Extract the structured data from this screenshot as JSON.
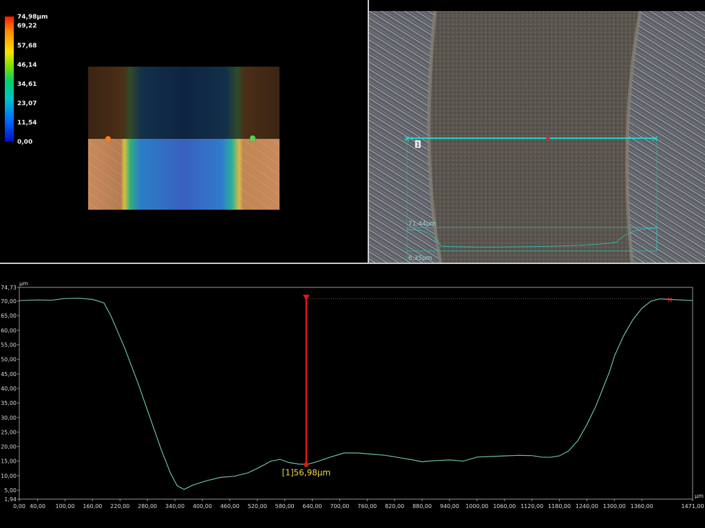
{
  "color_scale": {
    "labels": [
      "74,98µm",
      "69,22",
      "57,68",
      "46,14",
      "34,61",
      "23,07",
      "11,54",
      "0,00"
    ],
    "colors": [
      "#ff1a00",
      "#ff8a00",
      "#ffe000",
      "#7be000",
      "#00d070",
      "#00c4c8",
      "#0070ff",
      "#0010c8"
    ]
  },
  "optical_view": {
    "marker_label": "1",
    "height_label": "71,44µm",
    "depth_label": "6,35µm",
    "line_color": "#20d8d0"
  },
  "profile": {
    "unit_y": "µm",
    "unit_x": "µm",
    "measurement_label": "[1]56,98µm",
    "y_ticks": [
      "74,73",
      "70,00",
      "65,00",
      "60,00",
      "55,00",
      "50,00",
      "45,00",
      "40,00",
      "35,00",
      "30,00",
      "25,00",
      "20,00",
      "15,00",
      "10,00",
      "5,00",
      "1,94"
    ],
    "x_ticks": [
      "0,00",
      "40,00",
      "100,00",
      "160,00",
      "220,00",
      "280,00",
      "340,00",
      "400,00",
      "460,00",
      "520,00",
      "580,00",
      "640,00",
      "700,00",
      "760,00",
      "820,00",
      "880,00",
      "940,00",
      "1000,00",
      "1060,00",
      "1120,00",
      "1180,00",
      "1240,00",
      "1300,00",
      "1360,00",
      "1471,00"
    ]
  },
  "chart_data": {
    "type": "line",
    "title": "",
    "xlabel": "µm",
    "ylabel": "µm",
    "xlim": [
      0,
      1471
    ],
    "ylim": [
      1.94,
      74.73
    ],
    "series": [
      {
        "color": "#6fc1a6",
        "x": [
          0,
          40,
          70,
          100,
          130,
          160,
          185,
          200,
          230,
          260,
          290,
          310,
          330,
          345,
          360,
          380,
          410,
          440,
          470,
          500,
          520,
          550,
          570,
          590,
          610,
          630,
          650,
          680,
          710,
          740,
          770,
          800,
          830,
          860,
          880,
          910,
          940,
          970,
          1000,
          1030,
          1060,
          1090,
          1120,
          1140,
          1160,
          1180,
          1200,
          1220,
          1240,
          1260,
          1275,
          1290,
          1300,
          1320,
          1340,
          1360,
          1380,
          1400,
          1420,
          1471
        ],
        "y": [
          70.2,
          70.4,
          70.3,
          70.9,
          71.0,
          70.6,
          69.4,
          65.0,
          54.0,
          41.5,
          28.0,
          19.0,
          11.0,
          6.5,
          5.3,
          6.8,
          8.3,
          9.4,
          9.8,
          11.0,
          12.5,
          15.0,
          15.6,
          14.5,
          14.0,
          13.9,
          14.8,
          16.4,
          17.8,
          17.8,
          17.4,
          17.0,
          16.2,
          15.4,
          14.8,
          15.2,
          15.4,
          15.0,
          16.4,
          16.6,
          16.8,
          17.0,
          16.9,
          16.4,
          16.3,
          16.8,
          18.5,
          22.0,
          27.5,
          34.0,
          40.0,
          46.0,
          51.0,
          58.0,
          63.5,
          67.5,
          70.0,
          70.8,
          70.6,
          70.2
        ]
      }
    ],
    "annotations": [
      {
        "label": "[1]56,98µm",
        "x": 627,
        "y_top": 70.8,
        "y_bottom": 13.82
      }
    ],
    "grid": false
  }
}
